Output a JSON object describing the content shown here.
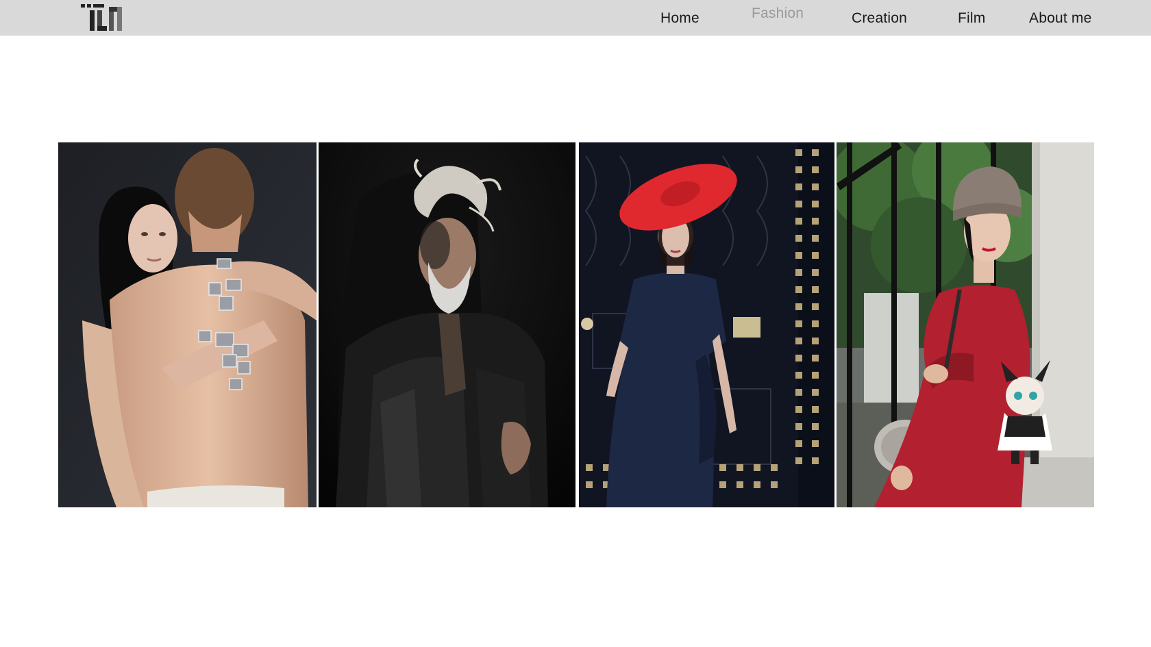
{
  "header": {
    "logo_name": "tm-logo",
    "nav": [
      {
        "label": "Home",
        "active": false
      },
      {
        "label": "Fashion",
        "active": true
      },
      {
        "label": "Creation",
        "active": false
      },
      {
        "label": "Film",
        "active": false
      },
      {
        "label": "About me",
        "active": false
      }
    ]
  },
  "gallery": {
    "photos": [
      {
        "subject": "couple-embrace-jewelry-portrait"
      },
      {
        "subject": "bearded-man-leather-jacket-portrait"
      },
      {
        "subject": "woman-red-hat-navy-dress-portrait"
      },
      {
        "subject": "woman-red-dress-fur-hat-portrait"
      }
    ]
  },
  "colors": {
    "header_bg": "#d9d9d9",
    "nav_text": "#1a1a1a",
    "nav_active": "#9a9a9a",
    "page_bg": "#ffffff"
  }
}
